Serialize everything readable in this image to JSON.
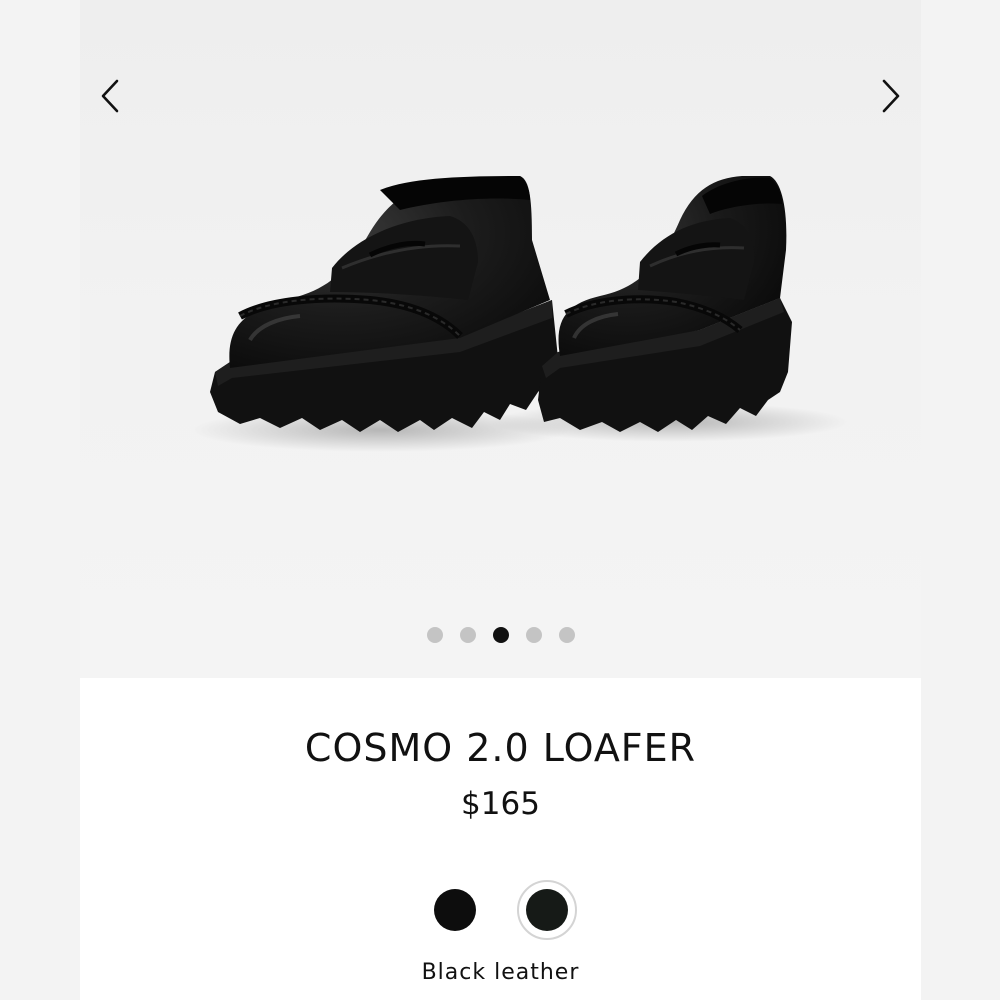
{
  "product": {
    "title": "COSMO 2.0 LOAFER",
    "price": "$165",
    "selected_color_name": "Black leather"
  },
  "carousel": {
    "prev_icon": "chevron-left-icon",
    "next_icon": "chevron-right-icon",
    "slide_count": 5,
    "active_slide": 3
  },
  "swatches": [
    {
      "name": "black",
      "color": "#0d0d0d",
      "selected": false
    },
    {
      "name": "black-leather",
      "color": "#161a17",
      "selected": true
    }
  ],
  "colors": {
    "dot_inactive": "#c4c4c4",
    "dot_active": "#111111",
    "text": "#111111"
  }
}
